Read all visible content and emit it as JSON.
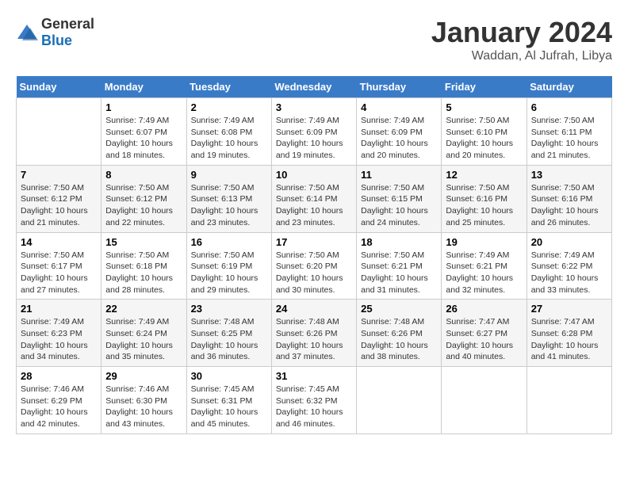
{
  "logo": {
    "text_general": "General",
    "text_blue": "Blue"
  },
  "title": "January 2024",
  "subtitle": "Waddan, Al Jufrah, Libya",
  "days_of_week": [
    "Sunday",
    "Monday",
    "Tuesday",
    "Wednesday",
    "Thursday",
    "Friday",
    "Saturday"
  ],
  "weeks": [
    [
      {
        "day": "",
        "sunrise": "",
        "sunset": "",
        "daylight": ""
      },
      {
        "day": "1",
        "sunrise": "Sunrise: 7:49 AM",
        "sunset": "Sunset: 6:07 PM",
        "daylight": "Daylight: 10 hours and 18 minutes."
      },
      {
        "day": "2",
        "sunrise": "Sunrise: 7:49 AM",
        "sunset": "Sunset: 6:08 PM",
        "daylight": "Daylight: 10 hours and 19 minutes."
      },
      {
        "day": "3",
        "sunrise": "Sunrise: 7:49 AM",
        "sunset": "Sunset: 6:09 PM",
        "daylight": "Daylight: 10 hours and 19 minutes."
      },
      {
        "day": "4",
        "sunrise": "Sunrise: 7:49 AM",
        "sunset": "Sunset: 6:09 PM",
        "daylight": "Daylight: 10 hours and 20 minutes."
      },
      {
        "day": "5",
        "sunrise": "Sunrise: 7:50 AM",
        "sunset": "Sunset: 6:10 PM",
        "daylight": "Daylight: 10 hours and 20 minutes."
      },
      {
        "day": "6",
        "sunrise": "Sunrise: 7:50 AM",
        "sunset": "Sunset: 6:11 PM",
        "daylight": "Daylight: 10 hours and 21 minutes."
      }
    ],
    [
      {
        "day": "7",
        "sunrise": "Sunrise: 7:50 AM",
        "sunset": "Sunset: 6:12 PM",
        "daylight": "Daylight: 10 hours and 21 minutes."
      },
      {
        "day": "8",
        "sunrise": "Sunrise: 7:50 AM",
        "sunset": "Sunset: 6:12 PM",
        "daylight": "Daylight: 10 hours and 22 minutes."
      },
      {
        "day": "9",
        "sunrise": "Sunrise: 7:50 AM",
        "sunset": "Sunset: 6:13 PM",
        "daylight": "Daylight: 10 hours and 23 minutes."
      },
      {
        "day": "10",
        "sunrise": "Sunrise: 7:50 AM",
        "sunset": "Sunset: 6:14 PM",
        "daylight": "Daylight: 10 hours and 23 minutes."
      },
      {
        "day": "11",
        "sunrise": "Sunrise: 7:50 AM",
        "sunset": "Sunset: 6:15 PM",
        "daylight": "Daylight: 10 hours and 24 minutes."
      },
      {
        "day": "12",
        "sunrise": "Sunrise: 7:50 AM",
        "sunset": "Sunset: 6:16 PM",
        "daylight": "Daylight: 10 hours and 25 minutes."
      },
      {
        "day": "13",
        "sunrise": "Sunrise: 7:50 AM",
        "sunset": "Sunset: 6:16 PM",
        "daylight": "Daylight: 10 hours and 26 minutes."
      }
    ],
    [
      {
        "day": "14",
        "sunrise": "Sunrise: 7:50 AM",
        "sunset": "Sunset: 6:17 PM",
        "daylight": "Daylight: 10 hours and 27 minutes."
      },
      {
        "day": "15",
        "sunrise": "Sunrise: 7:50 AM",
        "sunset": "Sunset: 6:18 PM",
        "daylight": "Daylight: 10 hours and 28 minutes."
      },
      {
        "day": "16",
        "sunrise": "Sunrise: 7:50 AM",
        "sunset": "Sunset: 6:19 PM",
        "daylight": "Daylight: 10 hours and 29 minutes."
      },
      {
        "day": "17",
        "sunrise": "Sunrise: 7:50 AM",
        "sunset": "Sunset: 6:20 PM",
        "daylight": "Daylight: 10 hours and 30 minutes."
      },
      {
        "day": "18",
        "sunrise": "Sunrise: 7:50 AM",
        "sunset": "Sunset: 6:21 PM",
        "daylight": "Daylight: 10 hours and 31 minutes."
      },
      {
        "day": "19",
        "sunrise": "Sunrise: 7:49 AM",
        "sunset": "Sunset: 6:21 PM",
        "daylight": "Daylight: 10 hours and 32 minutes."
      },
      {
        "day": "20",
        "sunrise": "Sunrise: 7:49 AM",
        "sunset": "Sunset: 6:22 PM",
        "daylight": "Daylight: 10 hours and 33 minutes."
      }
    ],
    [
      {
        "day": "21",
        "sunrise": "Sunrise: 7:49 AM",
        "sunset": "Sunset: 6:23 PM",
        "daylight": "Daylight: 10 hours and 34 minutes."
      },
      {
        "day": "22",
        "sunrise": "Sunrise: 7:49 AM",
        "sunset": "Sunset: 6:24 PM",
        "daylight": "Daylight: 10 hours and 35 minutes."
      },
      {
        "day": "23",
        "sunrise": "Sunrise: 7:48 AM",
        "sunset": "Sunset: 6:25 PM",
        "daylight": "Daylight: 10 hours and 36 minutes."
      },
      {
        "day": "24",
        "sunrise": "Sunrise: 7:48 AM",
        "sunset": "Sunset: 6:26 PM",
        "daylight": "Daylight: 10 hours and 37 minutes."
      },
      {
        "day": "25",
        "sunrise": "Sunrise: 7:48 AM",
        "sunset": "Sunset: 6:26 PM",
        "daylight": "Daylight: 10 hours and 38 minutes."
      },
      {
        "day": "26",
        "sunrise": "Sunrise: 7:47 AM",
        "sunset": "Sunset: 6:27 PM",
        "daylight": "Daylight: 10 hours and 40 minutes."
      },
      {
        "day": "27",
        "sunrise": "Sunrise: 7:47 AM",
        "sunset": "Sunset: 6:28 PM",
        "daylight": "Daylight: 10 hours and 41 minutes."
      }
    ],
    [
      {
        "day": "28",
        "sunrise": "Sunrise: 7:46 AM",
        "sunset": "Sunset: 6:29 PM",
        "daylight": "Daylight: 10 hours and 42 minutes."
      },
      {
        "day": "29",
        "sunrise": "Sunrise: 7:46 AM",
        "sunset": "Sunset: 6:30 PM",
        "daylight": "Daylight: 10 hours and 43 minutes."
      },
      {
        "day": "30",
        "sunrise": "Sunrise: 7:45 AM",
        "sunset": "Sunset: 6:31 PM",
        "daylight": "Daylight: 10 hours and 45 minutes."
      },
      {
        "day": "31",
        "sunrise": "Sunrise: 7:45 AM",
        "sunset": "Sunset: 6:32 PM",
        "daylight": "Daylight: 10 hours and 46 minutes."
      },
      {
        "day": "",
        "sunrise": "",
        "sunset": "",
        "daylight": ""
      },
      {
        "day": "",
        "sunrise": "",
        "sunset": "",
        "daylight": ""
      },
      {
        "day": "",
        "sunrise": "",
        "sunset": "",
        "daylight": ""
      }
    ]
  ]
}
